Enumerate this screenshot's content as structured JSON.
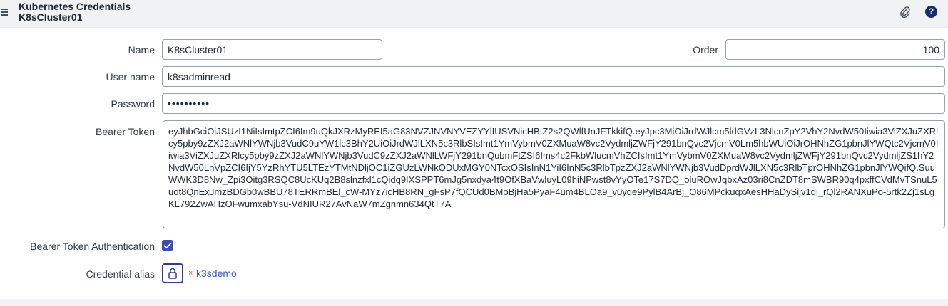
{
  "header": {
    "title": "Kubernetes Credentials",
    "subtitle": "K8sCluster01",
    "menu_icon": "hamburger-menu-icon",
    "attach_icon": "paperclip-icon",
    "help_icon": "help-icon",
    "help_glyph": "?"
  },
  "form": {
    "name_label": "Name",
    "name_value": "K8sCluster01",
    "order_label": "Order",
    "order_value": "100",
    "username_label": "User name",
    "username_value": "k8sadminread",
    "password_label": "Password",
    "password_value": "••••••••••",
    "bearer_token_label": "Bearer Token",
    "bearer_token_value": "eyJhbGciOiJSUzI1NiIsImtpZCI6Im9uQkJXRzMyREI5aG83NVZJNVNYVEZYYlIUSVNicHBtZ2s2QWlfUnJFTkkifQ.eyJpc3MiOiJrdWJlcm5ldGVzL3NlcnZpY2VhY2NvdW50Iiwia3ViZXJuZXRlcy5pby9zZXJ2aWNlYWNjb3VudC9uYW1lc3BhY2UiOiJrdWJlLXN5c3RlbSIsImt1YmVybmV0ZXMuaW8vc2VydmljZWFjY291bnQvc2VjcmV0Lm5hbWUiOiJrOHNhZG1pbnJlYWQtc2VjcmV0Iiwia3ViZXJuZXRlcy5pby9zZXJ2aWNlYWNjb3VudC9zZXJ2aWNlLWFjY291bnQubmFtZSI6Ims4c2FkbWlucmVhZCIsImt1YmVybmV0ZXMuaW8vc2VydmljZWFjY291bnQvc2VydmljZS1hY2NvdW50LnVpZCI6IjY5YzRhYTU5LTEzYTMtNDljOC1iZGUzLWNkODUxMGY0NTcxOSIsInN1YiI6InN5c3RlbTpzZXJ2aWNlYWNjb3VudDprdWJlLXN5c3RlbTprOHNhZG1pbnJlYWQifQ.SuuWWK3D8Nw_Zpi3Oitg3RSQC8UcKUq2B8slnzfxl1cQidq9IXSPPT6mJg5nxdya4t9OfXBaVwluyL09hiNPwst8vYyOTe17S7DQ_oluROwJqbxAz03ri8CnZDT8mSWBR90q4pxffCVdMvTSnuL5uot8QnExJmzBDGb0wBBU78TERRmBEl_cW-MYz7icHB8RN_gFsP7fQCUd0BMoBjHa5PyaF4um4BLOa9_v0yqe9PylB4ArBj_O86MPckuqxAesHHaDySijv1qi_rQl2RANXuPo-5rtk2Zj1sLgKL792ZwAHzOFwumxabYsu-VdNIUR27AvNaW7mZgnmn634QtT7A",
    "bearer_auth_label": "Bearer Token Authentication",
    "bearer_auth_checked": true,
    "credential_alias_label": "Credential alias",
    "credential_alias_remove": "×",
    "credential_alias_value": "k3sdemo",
    "lock_icon": "lock-icon"
  },
  "colors": {
    "accent": "#3b4db5",
    "link": "#3656c7",
    "header_bg": "#f1f2f4",
    "help_bg": "#1c2a74",
    "remove_red": "#d9534f"
  }
}
